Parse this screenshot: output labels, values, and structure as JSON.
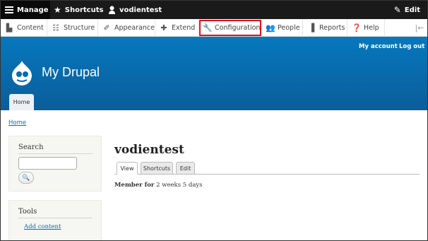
{
  "toolbar": {
    "manage": "Manage",
    "shortcuts": "Shortcuts",
    "user": "vodientest",
    "edit": "Edit"
  },
  "menu": {
    "items": [
      {
        "label": "Content",
        "icon": "file-icon"
      },
      {
        "label": "Structure",
        "icon": "sitemap-icon"
      },
      {
        "label": "Appearance",
        "icon": "paintbrush-icon"
      },
      {
        "label": "Extend",
        "icon": "puzzle-icon"
      },
      {
        "label": "Configuration",
        "icon": "wrench-icon"
      },
      {
        "label": "People",
        "icon": "people-icon"
      },
      {
        "label": "Reports",
        "icon": "bar-chart-icon"
      },
      {
        "label": "Help",
        "icon": "help-icon"
      }
    ],
    "highlighted": "Configuration"
  },
  "header": {
    "my_account": "My account",
    "log_out": "Log out",
    "site_name": "My Drupal",
    "home_tab": "Home",
    "brand_color": "#0678be"
  },
  "breadcrumb": "Home",
  "sidebar": {
    "search_title": "Search",
    "tools_title": "Tools",
    "add_content": "Add content"
  },
  "main": {
    "title": "vodientest",
    "tabs": [
      "View",
      "Shortcuts",
      "Edit"
    ],
    "member_label": "Member for",
    "member_value": "2 weeks 5 days"
  }
}
